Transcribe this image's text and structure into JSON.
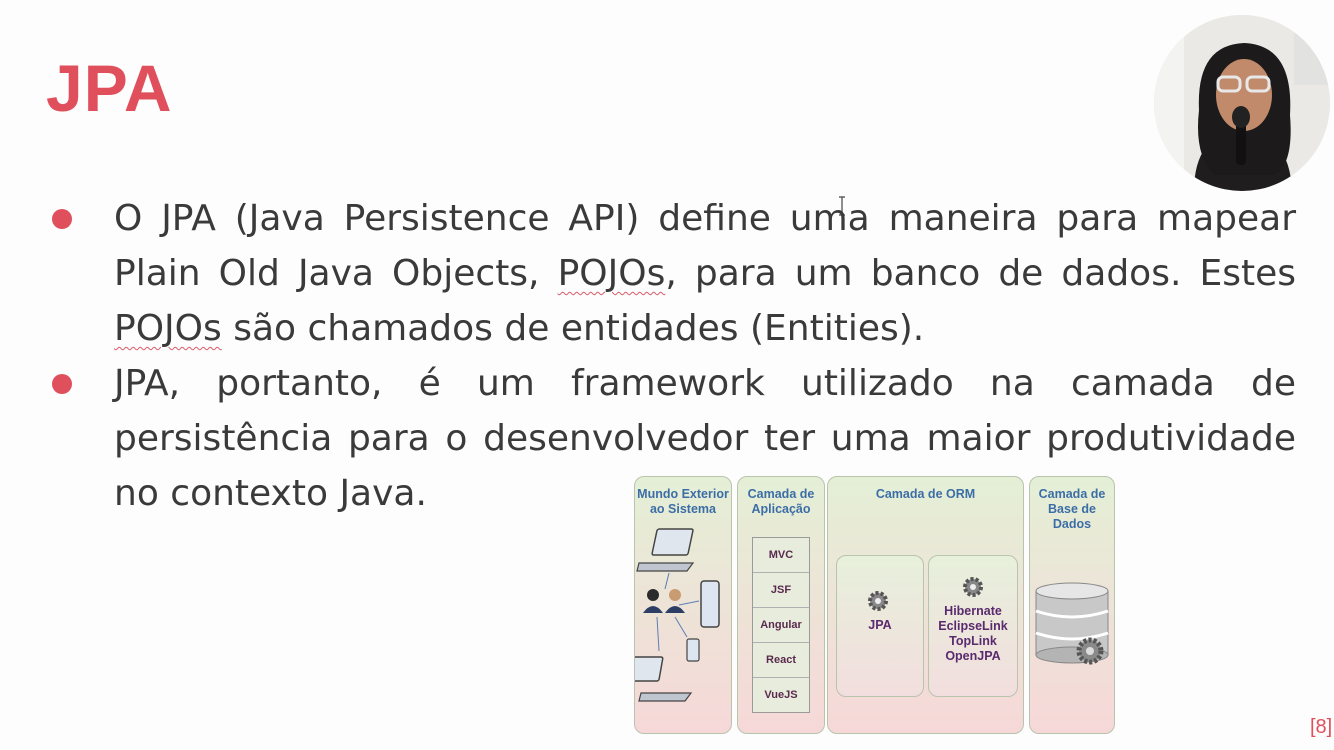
{
  "slide": {
    "title": "JPA",
    "bullet1": {
      "line1": "O JPA (Java Persistence API) define uma maneira para mapear",
      "line2_a": "Plain Old Java Objects, ",
      "line2_b": "POJOs",
      "line2_c": ", para um banco de dados. Estes",
      "line3_a": "POJOs",
      "line3_b": " são chamados de entidades (Entities)."
    },
    "bullet2": {
      "line1": "JPA, portanto, é um framework utilizado na camada de",
      "line2": "persistência para o desenvolvedor ter uma maior produtividade",
      "line3": "no contexto Java."
    },
    "page_number": "[8]"
  },
  "diagram": {
    "col1": "Mundo Exterior ao Sistema",
    "col2": "Camada de Aplicação",
    "col3": "Camada de ORM",
    "col4": "Camada de Base de Dados",
    "app_stack": [
      "MVC",
      "JSF",
      "Angular",
      "React",
      "VueJS"
    ],
    "jpa": "JPA",
    "impls": [
      "Hibernate",
      "EclipseLink",
      "TopLink",
      "OpenJPA"
    ]
  },
  "colors": {
    "accent": "#e0505c",
    "diagram_heading": "#3c6ea6",
    "diagram_text": "#5a2a6e"
  }
}
